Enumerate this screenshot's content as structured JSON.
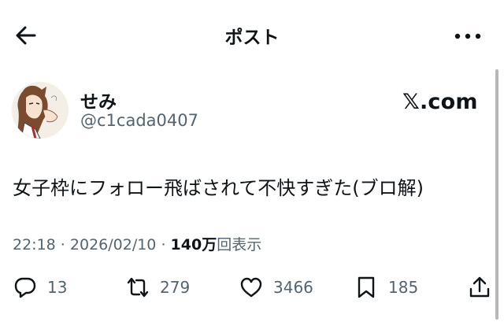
{
  "header": {
    "title": "ポスト",
    "back_icon": "arrow-left-icon",
    "more_icon": "more-horizontal-icon"
  },
  "author": {
    "display_name": "せみ",
    "handle": "@c1cada0407",
    "avatar": "avatar-illustration"
  },
  "source_brand": "𝕏.com",
  "post": {
    "text": "女子枠にフォロー飛ばされて不快すぎた(ブロ解)"
  },
  "meta": {
    "time": "22:18",
    "separator": " · ",
    "date": "2026/02/10",
    "separator2": " · ",
    "views_count": "140万",
    "views_label": "回表示"
  },
  "actions": {
    "replies": "13",
    "reposts": "279",
    "likes": "3466",
    "bookmarks": "185"
  },
  "colors": {
    "text": "#0f1419",
    "secondary": "#536471",
    "background": "#ffffff"
  }
}
